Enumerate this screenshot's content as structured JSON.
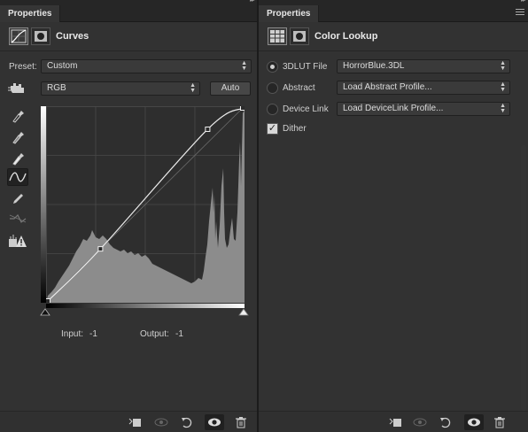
{
  "left_panel": {
    "tab_label": "Properties",
    "title": "Curves",
    "preset": {
      "label": "Preset:",
      "value": "Custom"
    },
    "channel": {
      "value": "RGB"
    },
    "auto_button": "Auto",
    "tools": [
      "eyedropper-black-icon",
      "eyedropper-gray-icon",
      "eyedropper-white-icon",
      "curve-points-tool-icon",
      "pencil-icon",
      "smooth-curve-icon",
      "clipping-warning-icon"
    ],
    "input": {
      "label": "Input:",
      "value": "-1"
    },
    "output": {
      "label": "Output:",
      "value": "-1"
    },
    "footer_icons": [
      "clip-to-layer-icon",
      "view-previous-state-icon",
      "reset-icon",
      "visibility-eye-icon",
      "trash-icon"
    ]
  },
  "right_panel": {
    "tab_label": "Properties",
    "title": "Color Lookup",
    "rows": [
      {
        "label": "3DLUT File",
        "value": "HorrorBlue.3DL",
        "selected": true
      },
      {
        "label": "Abstract",
        "value": "Load Abstract Profile...",
        "selected": false
      },
      {
        "label": "Device Link",
        "value": "Load DeviceLink Profile...",
        "selected": false
      }
    ],
    "dither": {
      "label": "Dither",
      "checked": true
    },
    "footer_icons": [
      "clip-to-layer-icon",
      "view-previous-state-icon",
      "reset-icon",
      "visibility-eye-icon",
      "trash-icon"
    ]
  },
  "colors": {
    "panel_bg": "#323232",
    "tab_bg": "#262626",
    "histogram": "#8a8a8a",
    "curve": "#e8e8e8"
  }
}
